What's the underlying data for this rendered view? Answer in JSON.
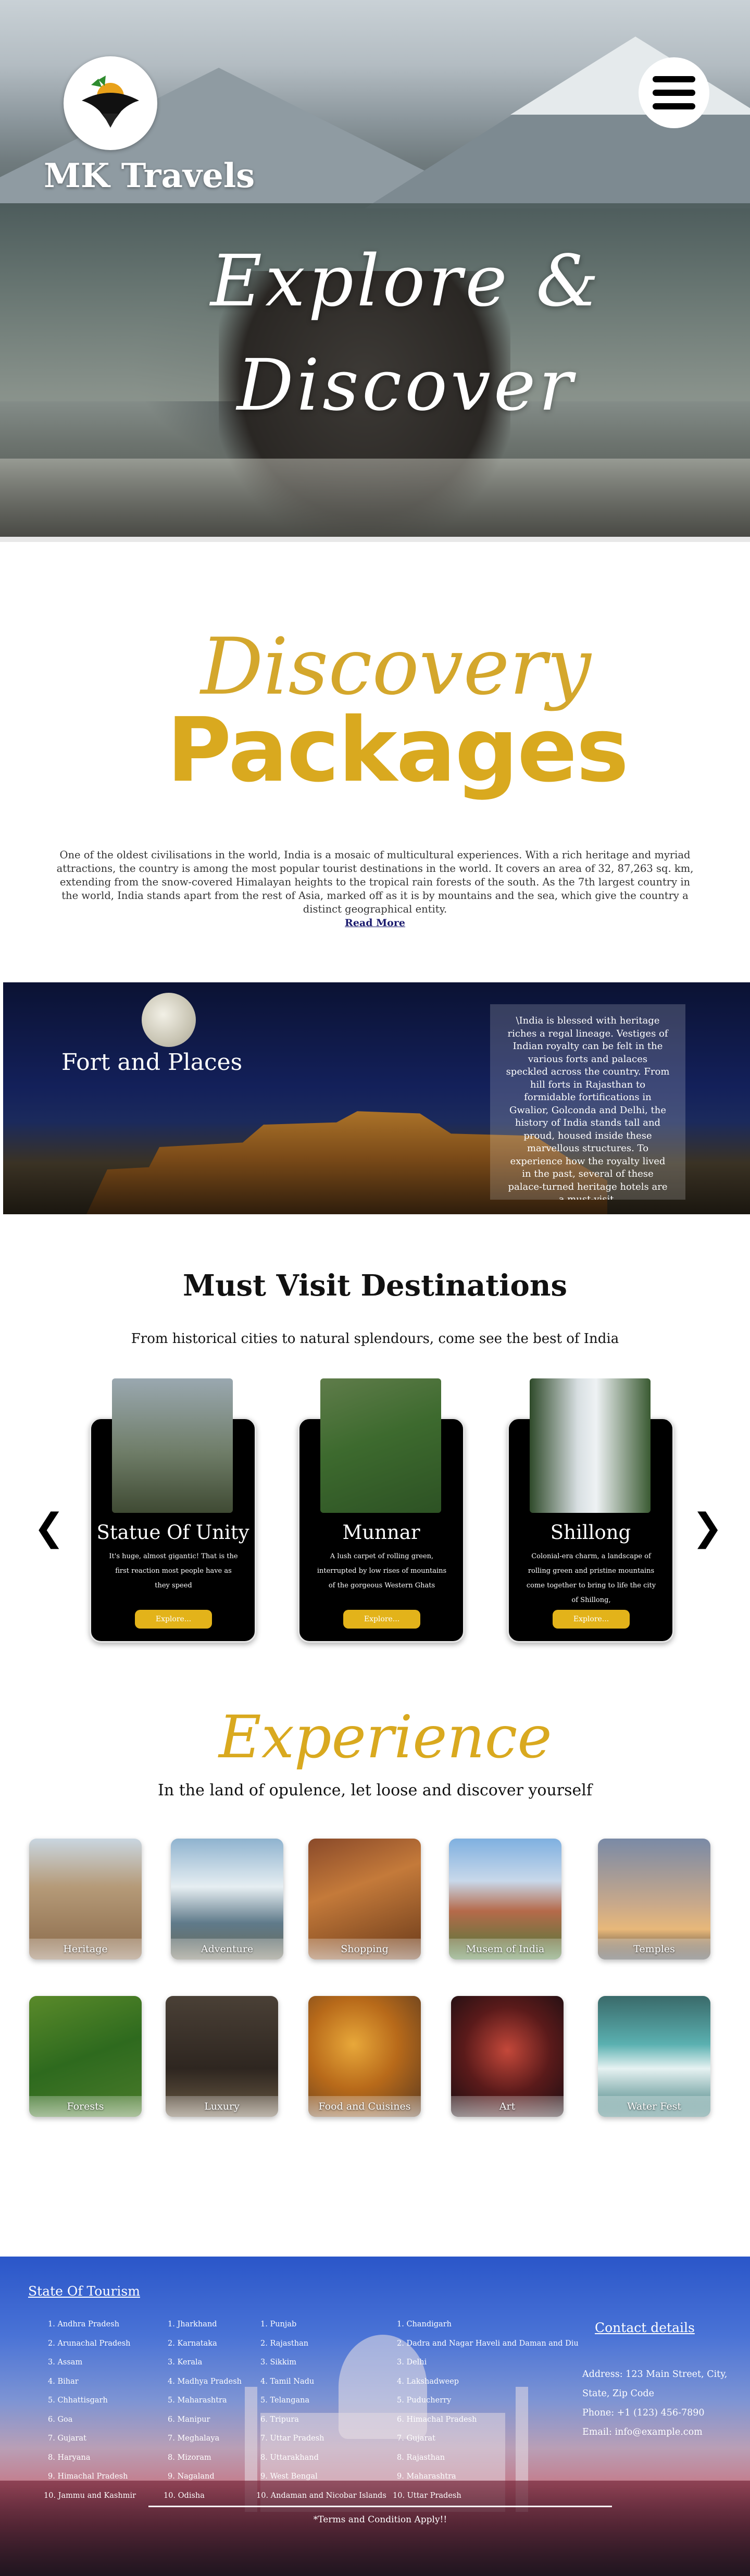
{
  "header": {
    "brand": "MK Travels",
    "hero_title_line1": "Explore &",
    "hero_title_line2": "Discover"
  },
  "discovery": {
    "script": "Discovery",
    "bold": "Packages",
    "intro": "One of the oldest civilisations in the world, India is a mosaic of multicultural experiences. With a rich heritage and myriad attractions, the country is among the most popular tourist destinations in the world. It covers an area of 32, 87,263 sq. km, extending from the snow-covered Himalayan heights to the tropical rain forests of the south. As the 7th largest country in the world, India stands apart from the rest of Asia, marked off as it is by mountains and the sea, which give the country a distinct geographical entity.",
    "read_more": "Read More"
  },
  "fort": {
    "title": "Fort and Places",
    "text": "\\India is blessed with heritage riches a regal lineage. Vestiges of Indian royalty can be felt in the various forts and palaces speckled across the country. From hill forts in Rajasthan to formidable fortifications in Gwalior, Golconda and Delhi, the history of India stands tall and proud, housed inside these marvellous structures. To experience how the royalty lived in the past, several of these palace-turned heritage hotels are a must-visit."
  },
  "destinations": {
    "title": "Must Visit Destinations",
    "subtitle": "From historical cities to natural splendours, come see the best of India",
    "cards": [
      {
        "name": "Statue Of Unity",
        "desc": "It's huge, almost gigantic! That is the first reaction most people have as they speed",
        "button": "Explore..."
      },
      {
        "name": "Munnar",
        "desc": "A lush carpet of rolling green, interrupted by low rises of mountains of the gorgeous Western Ghats",
        "button": "Explore..."
      },
      {
        "name": "Shillong",
        "desc": "Colonial-era charm, a landscape of rolling green and pristine mountains come together to bring to life the city of Shillong,",
        "button": "Explore..."
      }
    ]
  },
  "experience": {
    "script": "Experience",
    "subtitle": "In the land of opulence, let loose and discover yourself",
    "tiles": [
      "Heritage",
      "Adventure",
      "Shopping",
      "Musem of India",
      "Temples",
      "Forests",
      "Luxury",
      "Food and Cuisines",
      "Art",
      "Water Fest"
    ]
  },
  "footer": {
    "states_heading": "State Of Tourism",
    "col1": [
      "1. Andhra Pradesh",
      "2. Arunachal Pradesh",
      "3. Assam",
      "4. Bihar",
      "5. Chhattisgarh",
      "6. Goa",
      "7. Gujarat",
      "8. Haryana",
      "9. Himachal Pradesh",
      "10. Jammu and Kashmir"
    ],
    "col2": [
      "1. Jharkhand",
      "2. Karnataka",
      "3. Kerala",
      "4. Madhya Pradesh",
      "5. Maharashtra",
      "6. Manipur",
      "7. Meghalaya",
      "8. Mizoram",
      "9. Nagaland",
      "10. Odisha"
    ],
    "col3": [
      "1. Punjab",
      "2. Rajasthan",
      "3. Sikkim",
      "4. Tamil Nadu",
      "5. Telangana",
      "6. Tripura",
      "7. Uttar Pradesh",
      "8. Uttarakhand",
      "9. West Bengal",
      "10. Andaman and Nicobar Islands"
    ],
    "col4": [
      "1. Chandigarh",
      "2. Dadra and Nagar Haveli and Daman and Diu",
      "3. Delhi",
      "4. Lakshadweep",
      "5. Puducherry",
      "6. Himachal Pradesh",
      "7. Gujarat",
      "8. Rajasthan",
      "9. Maharashtra",
      "10. Uttar Pradesh"
    ],
    "contact_heading": "Contact details",
    "address": "Address: 123 Main Street, City, State, Zip Code",
    "phone": "Phone: +1 (123) 456-7890",
    "email": "Email: info@example.com",
    "terms": "*Terms and Condition Apply!!"
  },
  "colors": {
    "gold": "#d9a91f",
    "button_gold": "#e3b31a",
    "link_blue": "#1a1a6e"
  }
}
